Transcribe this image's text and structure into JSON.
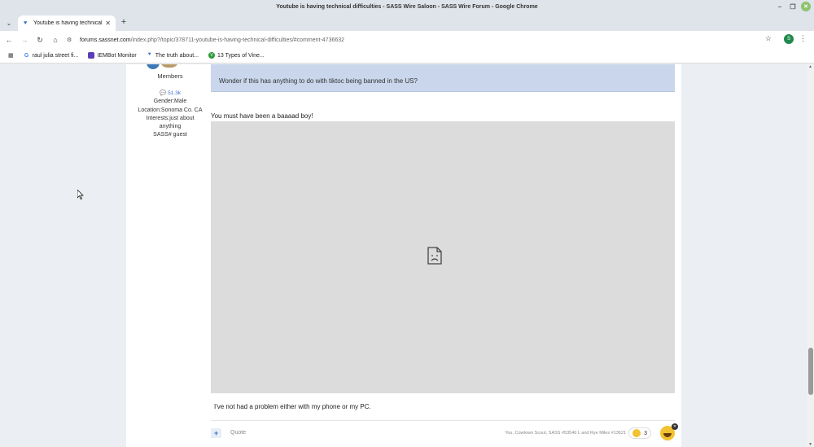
{
  "window": {
    "title": "Youtube is having technical difficulties - SASS Wire Saloon - SASS Wire Forum - Google Chrome",
    "minimize_icon": "minimize-icon",
    "restore_icon": "restore-icon",
    "close_icon": "close-icon"
  },
  "tabs": [
    {
      "label": "Youtube is having technical",
      "active": true
    }
  ],
  "toolbar": {
    "url_host": "forums.sassnet.com",
    "url_path": "/index.php?/topic/378711-youtube-is-having-technical-difficulties/#comment-4736632",
    "profile_initial": "S"
  },
  "bookmarks": [
    {
      "label": "raul julia street fi...",
      "icon": "google-icon"
    },
    {
      "label": "IEMBot Monitor",
      "icon": "iembot-icon"
    },
    {
      "label": "The truth about...",
      "icon": "vine-icon"
    },
    {
      "label": "13 Types of Vine...",
      "icon": "vine-icon-green"
    }
  ],
  "author": {
    "group": "Members",
    "post_count": "51.3k",
    "gender": "Gender:Male",
    "location": "Location:Sonoma Co. CA",
    "interests": "Interests:just about anything",
    "sass": "SASS# guest"
  },
  "post": {
    "quote_text": "Wonder if this has anything to do with tiktoc being banned in the US?",
    "reply_line": "You must have been a baaaad boy!",
    "body_line": "I've not had a problem either with my phone or my PC.",
    "multiquote_label": "+",
    "quote_label": "Quote",
    "reactions_text": "You, Cowtown Scout, SASS #53540 L and Rye Miles #13621",
    "reaction_count": "3"
  }
}
